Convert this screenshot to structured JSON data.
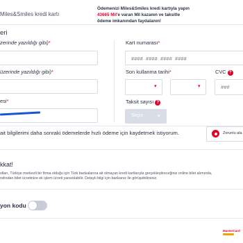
{
  "header": {
    "card_label": "Miles&Smiles kredi kartı",
    "promo_line1": "Ödemenizi Miles&Smiles kredi kartıyla yapın",
    "promo_line2_red": "43665 Mil",
    "promo_line2_rest": "'e varan Mil kazanın ve taksitle",
    "promo_line3": "ödeme imkanından faydalanın!"
  },
  "section_title": "eri",
  "form": {
    "name_label": "zerinde yazıldığı gibi)",
    "surname_label": "üzerinde yazıldığı gibi)",
    "mail_label": "esi",
    "card_number_label": "Kart numarası",
    "card_number_placeholder": "#### #### #### ####",
    "expiry_label": "Son kullanma tarihi",
    "cvc_label": "CVC",
    "cvc_placeholder": "###",
    "installment_label": "Taksit sayısı",
    "installment_value": "Seçin",
    "required_mark": "*",
    "help_mark": "?",
    "chevron": "▾"
  },
  "save": {
    "text": "ait bilgilerimi daha sonraki ödemelerde hızlı ödeme için kaydetmek istiyorum.",
    "required_text": "Zorunlu ala"
  },
  "notice": {
    "title": "kkat!",
    "line1": "olları, Türkiye merkezli bir firma olduğu için Türk bankalarına ait olmayan kredi kartlarıyla gerçekleştireceğiniz online bilet alımında,",
    "line2": "rafından bilet ücretinize ek işlem ücreti yansıtılabilir. Detaylı bilgi için bankanız ile görüşebilirsiniz."
  },
  "promo_code": {
    "label": "yon kodu"
  },
  "footer": {
    "logo_text": "MasterCard"
  },
  "colors": {
    "accent": "#e5002b",
    "text": "#2b3141",
    "border": "#d7dbe3",
    "underline": "#1a53d8"
  }
}
